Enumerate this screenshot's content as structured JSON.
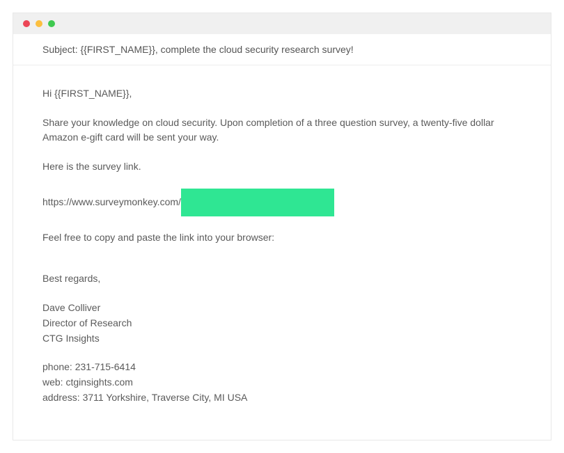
{
  "titlebar": {
    "close": "close",
    "minimize": "minimize",
    "zoom": "zoom"
  },
  "email": {
    "subject_label": "Subject: ",
    "subject_text": "{{FIRST_NAME}}, complete the cloud security research survey!",
    "greeting": "Hi {{FIRST_NAME}},",
    "para1": "Share your knowledge on cloud security.  Upon completion of a three question survey, a twenty-five dollar Amazon e-gift card will be sent your way.",
    "para2": "Here is the survey link.",
    "link_prefix": "https://www.surveymonkey.com/",
    "para3": "Feel free to copy and paste the link into your browser:",
    "signoff": "Best regards,",
    "sender_name": "Dave Colliver",
    "sender_title": "Director of Research",
    "sender_org": "CTG Insights",
    "phone_line": "phone: 231-715-6414",
    "web_line": "web: ctginsights.com",
    "address_line": "address: 3711 Yorkshire, Traverse City, MI  USA"
  }
}
